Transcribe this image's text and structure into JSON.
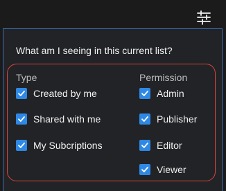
{
  "header": {
    "filter_icon": "sliders-icon"
  },
  "panel": {
    "question": "What am I seeing in this current list?",
    "type": {
      "heading": "Type",
      "options": [
        {
          "label": "Created by me",
          "checked": true
        },
        {
          "label": "Shared with me",
          "checked": true
        },
        {
          "label": "My Subcriptions",
          "checked": true
        }
      ]
    },
    "permission": {
      "heading": "Permission",
      "options": [
        {
          "label": "Admin",
          "checked": true
        },
        {
          "label": "Publisher",
          "checked": true
        },
        {
          "label": "Editor",
          "checked": true
        },
        {
          "label": "Viewer",
          "checked": true
        }
      ]
    }
  },
  "colors": {
    "background": "#1b1b1b",
    "panel": "#222326",
    "panel_border": "#3d6fb3",
    "checkbox": "#2e89e6",
    "highlight": "#d9463b"
  }
}
